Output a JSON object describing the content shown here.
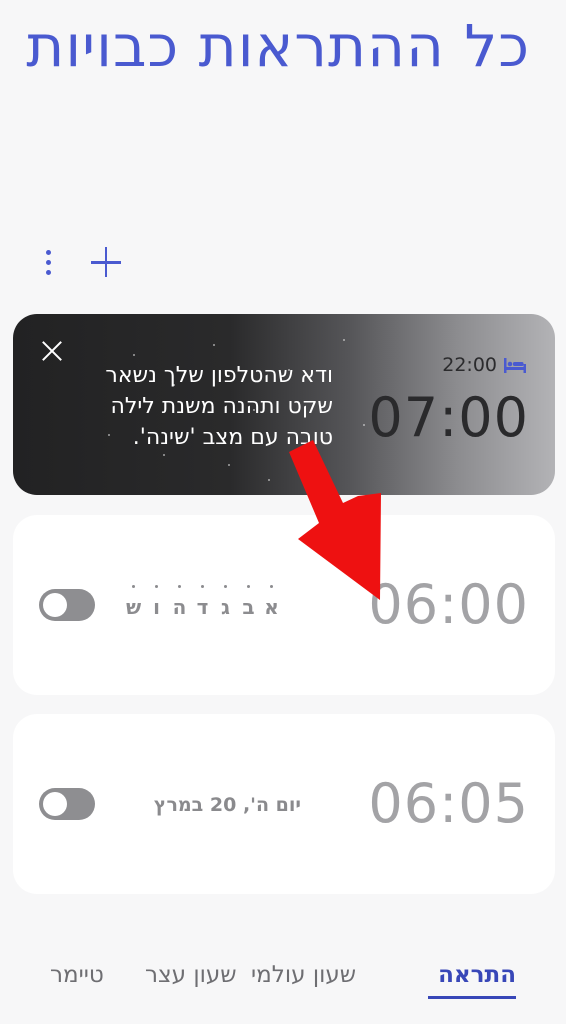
{
  "header": {
    "title": "כל ההתראות כבויות"
  },
  "toolbar": {
    "more_icon": "more-vertical-icon",
    "add_icon": "plus-icon"
  },
  "bedtime_card": {
    "tip_text": "ודא שהטלפון שלך נשאר שקט ותהנה משנת לילה טובה עם מצב 'שינה'.",
    "bedtime": "22:00",
    "wake_time": "07:00",
    "bed_icon": "bed-icon",
    "close_icon": "close-icon"
  },
  "alarms": [
    {
      "time": "06:00",
      "days": [
        "א",
        "ב",
        "ג",
        "ד",
        "ה",
        "ו",
        "ש"
      ],
      "enabled": true
    },
    {
      "time": "06:05",
      "date_label": "יום ה', 20 במרץ",
      "enabled": true
    }
  ],
  "tabs": {
    "alarm": "התראה",
    "world_clock": "שעון עולמי",
    "stopwatch": "שעון עצר",
    "timer": "טיימר",
    "active": "alarm"
  },
  "colors": {
    "accent": "#4a5ad0",
    "annotation_arrow": "#ee1111"
  }
}
